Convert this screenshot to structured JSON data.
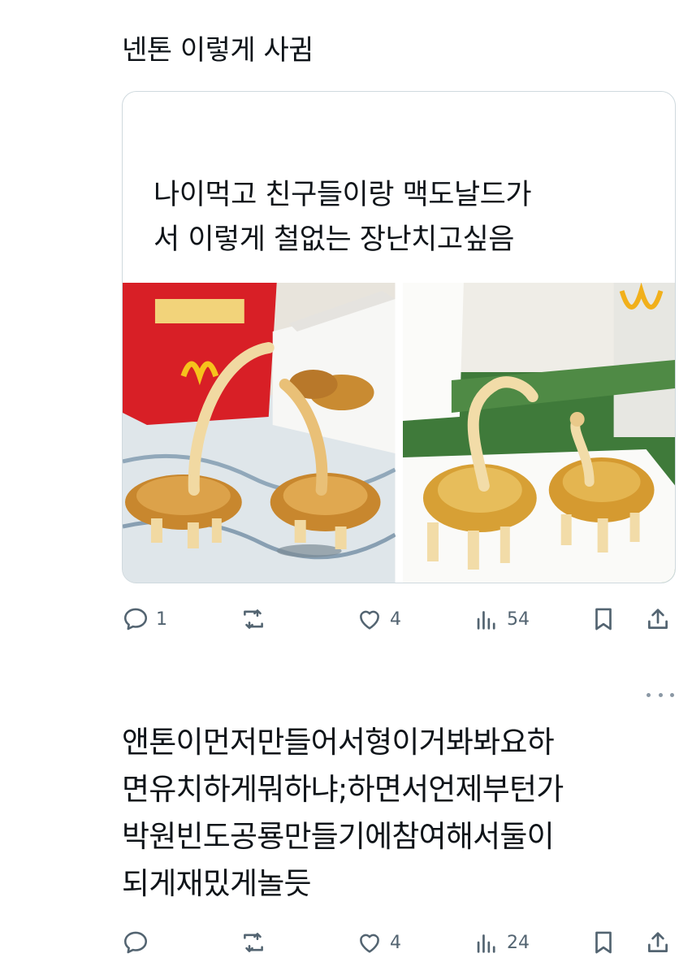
{
  "post": {
    "text": "넨톤 이렇게 사귐",
    "quote": {
      "text_line1": "나이먹고 친구들이랑 맥도날드가",
      "text_line2": "서 이렇게 철없는 장난치고싶음",
      "media": [
        {
          "name": "photo-nugget-dinosaurs-table"
        },
        {
          "name": "photo-nugget-dinosaurs-tray"
        }
      ]
    },
    "actions": {
      "reply_count": "1",
      "repost_count": "",
      "like_count": "4",
      "views_count": "54"
    }
  },
  "reply": {
    "lines": [
      "앤톤이먼저만들어서형이거봐봐요하",
      "면유치하게뭐하냐;하면서언제부턴가",
      "박원빈도공룡만들기에참여해서둘이",
      "되게재밌게놀듯"
    ],
    "actions": {
      "reply_count": "",
      "repost_count": "",
      "like_count": "4",
      "views_count": "24"
    }
  },
  "icons": [
    "reply-icon",
    "repost-icon",
    "like-icon",
    "views-icon",
    "bookmark-icon",
    "share-icon",
    "more-icon"
  ],
  "colors": {
    "text": "#0f1419",
    "muted": "#536471",
    "border": "#cfd9de"
  }
}
